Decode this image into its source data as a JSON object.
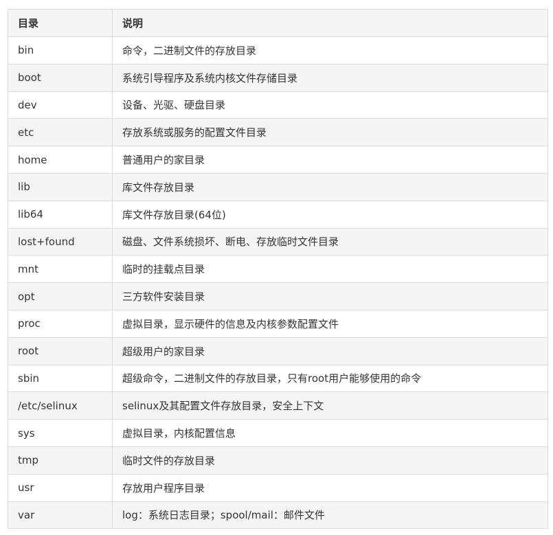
{
  "table": {
    "headers": [
      "目录",
      "说明"
    ],
    "rows": [
      [
        "bin",
        "命令，二进制文件的存放目录"
      ],
      [
        "boot",
        "系统引导程序及系统内核文件存储目录"
      ],
      [
        "dev",
        "设备、光驱、硬盘目录"
      ],
      [
        "etc",
        "存放系统或服务的配置文件目录"
      ],
      [
        "home",
        "普通用户的家目录"
      ],
      [
        "lib",
        "库文件存放目录"
      ],
      [
        "lib64",
        "库文件存放目录(64位)"
      ],
      [
        "lost+found",
        "磁盘、文件系统损坏、断电、存放临时文件目录"
      ],
      [
        "mnt",
        "临时的挂载点目录"
      ],
      [
        "opt",
        "三方软件安装目录"
      ],
      [
        "proc",
        "虚拟目录，显示硬件的信息及内核参数配置文件"
      ],
      [
        "root",
        "超级用户的家目录"
      ],
      [
        "sbin",
        "超级命令，二进制文件的存放目录，只有root用户能够使用的命令"
      ],
      [
        "/etc/selinux",
        "selinux及其配置文件存放目录，安全上下文"
      ],
      [
        "sys",
        "虚拟目录，内核配置信息"
      ],
      [
        "tmp",
        "临时文件的存放目录"
      ],
      [
        "usr",
        "存放用户程序目录"
      ],
      [
        "var",
        "log：系统日志目录；spool/mail：邮件文件"
      ]
    ]
  }
}
